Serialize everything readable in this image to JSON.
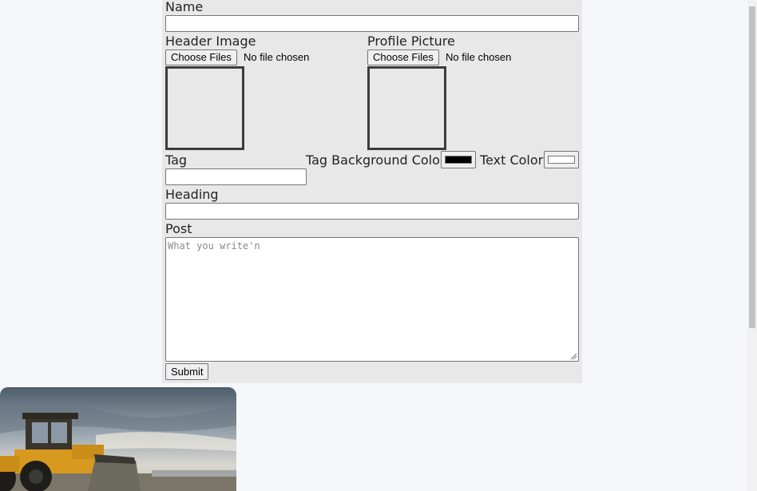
{
  "form": {
    "name_label": "Name",
    "name_value": "",
    "header_image_label": "Header Image",
    "header_image_button": "Choose Files",
    "header_image_status": "No file chosen",
    "profile_picture_label": "Profile Picture",
    "profile_picture_button": "Choose Files",
    "profile_picture_status": "No file chosen",
    "tag_label": "Tag",
    "tag_value": "",
    "tag_bg_color_label": "Tag Background Color",
    "tag_bg_color_value": "#000000",
    "text_color_label": "Text Color",
    "text_color_value": "#ffffff",
    "heading_label": "Heading",
    "heading_value": "",
    "post_label": "Post",
    "post_placeholder": "What you write'n",
    "submit_label": "Submit"
  },
  "colors": {
    "page_background": "#f5f7fb",
    "panel_background": "#e8e8e8"
  },
  "card": {
    "image": "excavator-photo"
  }
}
